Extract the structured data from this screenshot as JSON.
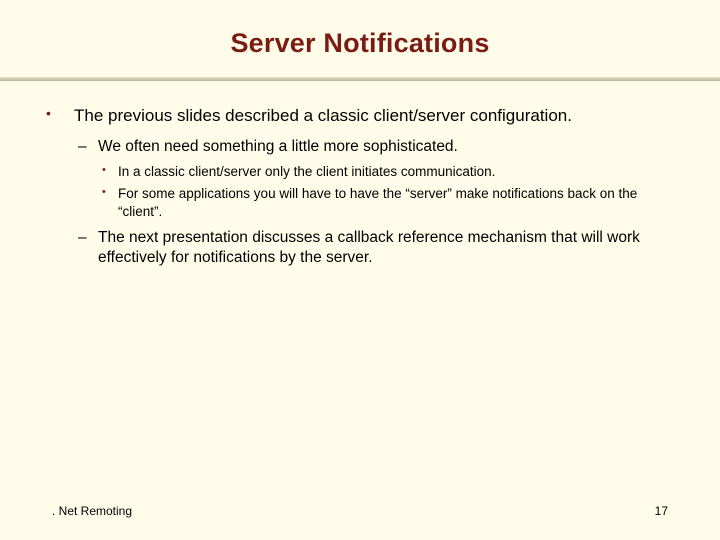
{
  "title": "Server Notifications",
  "bullets": {
    "lvl1": [
      {
        "text": "The previous slides described a classic client/server configuration.",
        "lvl2": [
          {
            "text": "We often need something a little more sophisticated.",
            "lvl3": [
              {
                "text": "In a classic client/server only the client initiates communication."
              },
              {
                "text": "For some applications you will have to have the “server” make notifications back on the “client”."
              }
            ]
          },
          {
            "text": "The next presentation discusses a callback reference mechanism that will work effectively for notifications by the server.",
            "lvl3": []
          }
        ]
      }
    ]
  },
  "footer": {
    "left": ". Net Remoting",
    "right": "17"
  }
}
